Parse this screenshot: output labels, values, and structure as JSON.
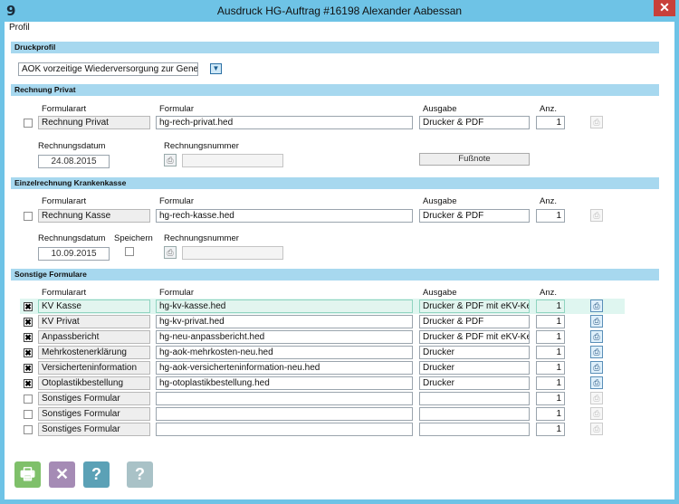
{
  "window": {
    "title": "Ausdruck HG-Auftrag #16198 Alexander Aabessan",
    "app_icon": "9",
    "close": "✕"
  },
  "menu": {
    "profil": "Profil"
  },
  "druckprofil": {
    "header": "Druckprofil",
    "selected": "AOK vorzeitige Wiederversorgung zur Gene"
  },
  "columns": {
    "formularart": "Formularart",
    "formular": "Formular",
    "ausgabe": "Ausgabe",
    "anz": "Anz."
  },
  "rechnung_privat": {
    "header": "Rechnung Privat",
    "formularart": "Rechnung Privat",
    "formular": "hg-rech-privat.hed",
    "ausgabe": "Drucker & PDF",
    "anz": "1",
    "datum_label": "Rechnungsdatum",
    "datum": "24.08.2015",
    "nummer_label": "Rechnungsnummer",
    "nummer": "",
    "fussnote": "Fußnote"
  },
  "einzelrechnung": {
    "header": "Einzelrechnung Krankenkasse",
    "formularart": "Rechnung Kasse",
    "formular": "hg-rech-kasse.hed",
    "ausgabe": "Drucker & PDF",
    "anz": "1",
    "datum_label": "Rechnungsdatum",
    "datum": "10.09.2015",
    "speichern_label": "Speichern",
    "nummer_label": "Rechnungsnummer",
    "nummer": ""
  },
  "sonstige": {
    "header": "Sonstige Formulare",
    "rows": [
      {
        "checked": true,
        "formularart": "KV Kasse",
        "formular": "hg-kv-kasse.hed",
        "ausgabe": "Drucker & PDF mit eKV-Ker",
        "anz": "1"
      },
      {
        "checked": true,
        "formularart": "KV Privat",
        "formular": "hg-kv-privat.hed",
        "ausgabe": "Drucker & PDF",
        "anz": "1"
      },
      {
        "checked": true,
        "formularart": "Anpassbericht",
        "formular": "hg-neu-anpassbericht.hed",
        "ausgabe": "Drucker & PDF mit eKV-Ker",
        "anz": "1"
      },
      {
        "checked": true,
        "formularart": "Mehrkostenerklärung",
        "formular": "hg-aok-mehrkosten-neu.hed",
        "ausgabe": "Drucker",
        "anz": "1"
      },
      {
        "checked": true,
        "formularart": "Versicherteninformation",
        "formular": "hg-aok-versicherteninformation-neu.hed",
        "ausgabe": "Drucker",
        "anz": "1"
      },
      {
        "checked": true,
        "formularart": "Otoplastikbestellung",
        "formular": "hg-otoplastikbestellung.hed",
        "ausgabe": "Drucker",
        "anz": "1"
      },
      {
        "checked": false,
        "formularart": "Sonstiges Formular",
        "formular": "",
        "ausgabe": "",
        "anz": "1"
      },
      {
        "checked": false,
        "formularart": "Sonstiges Formular",
        "formular": "",
        "ausgabe": "",
        "anz": "1"
      },
      {
        "checked": false,
        "formularart": "Sonstiges Formular",
        "formular": "",
        "ausgabe": "",
        "anz": "1"
      }
    ]
  },
  "footer": {
    "print": "🖶",
    "cancel": "✕",
    "help": "?",
    "help2": "?"
  },
  "glyphs": {
    "checkmark": "✖",
    "dropdown": "▼",
    "form_icon": "⎙"
  },
  "colors": {
    "titlebar": "#6ec3e6",
    "section": "#a7d8ef",
    "print_btn": "#7fc06a",
    "cancel_btn": "#a58bb5",
    "help_btn": "#5ba1b6",
    "help2_btn": "#a9c2c7",
    "highlight": "#dff6f0"
  }
}
